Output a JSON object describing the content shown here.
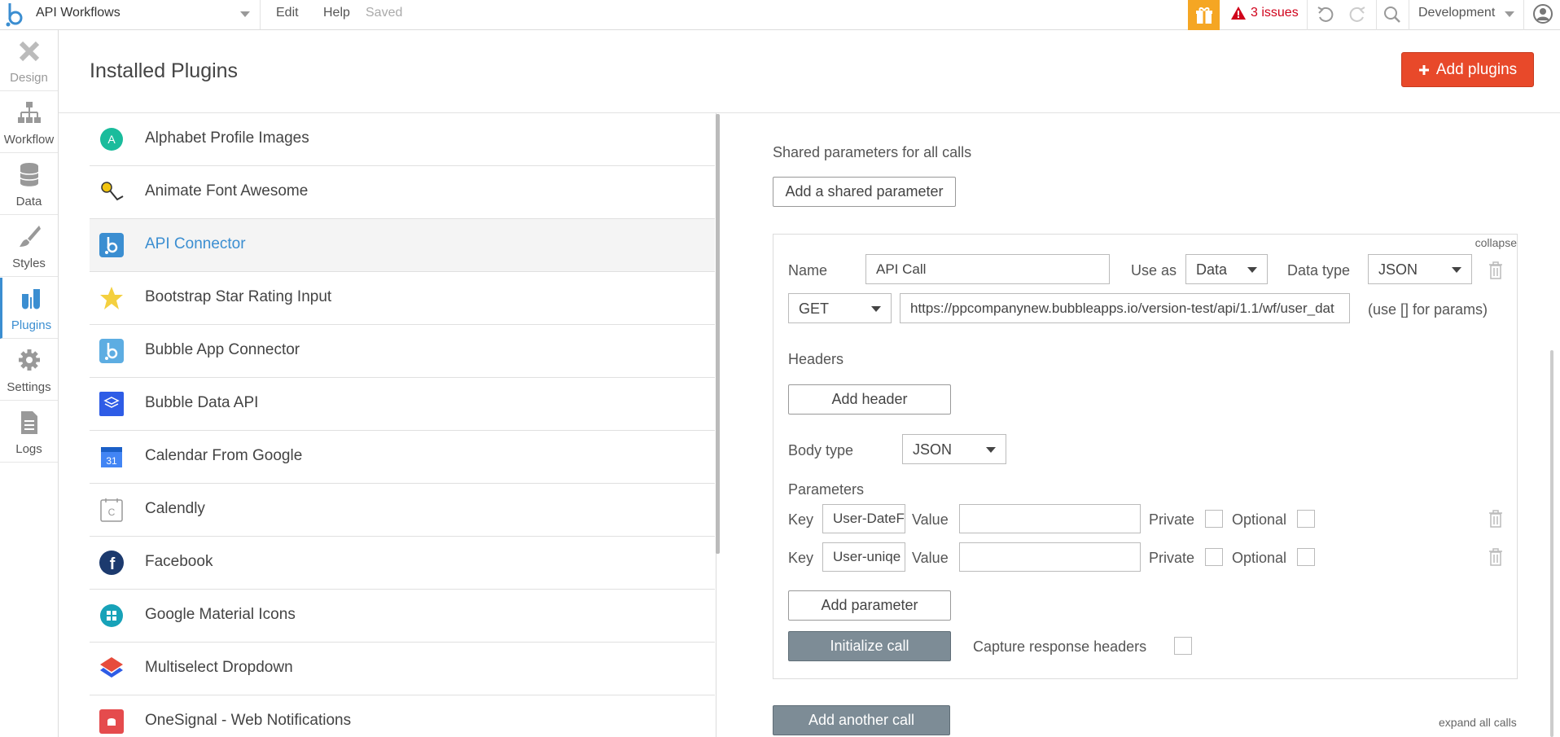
{
  "topbar": {
    "page_name": "API Workflows",
    "edit": "Edit",
    "help": "Help",
    "saved": "Saved",
    "issues": "3 issues",
    "environment": "Development"
  },
  "leftnav": {
    "items": [
      {
        "label": "Design",
        "icon": "design-icon"
      },
      {
        "label": "Workflow",
        "icon": "workflow-icon"
      },
      {
        "label": "Data",
        "icon": "database-icon"
      },
      {
        "label": "Styles",
        "icon": "brush-icon"
      },
      {
        "label": "Plugins",
        "icon": "plugins-icon"
      },
      {
        "label": "Settings",
        "icon": "gear-icon"
      },
      {
        "label": "Logs",
        "icon": "document-icon"
      }
    ],
    "active": "Plugins"
  },
  "header": {
    "title": "Installed Plugins",
    "add_plugins": "Add plugins"
  },
  "plugins": [
    {
      "name": "Alphabet Profile Images",
      "icon": "alphabet-icon"
    },
    {
      "name": "Animate Font Awesome",
      "icon": "animate-icon"
    },
    {
      "name": "API Connector",
      "icon": "bubble-icon",
      "selected": true
    },
    {
      "name": "Bootstrap Star Rating Input",
      "icon": "star-icon"
    },
    {
      "name": "Bubble App Connector",
      "icon": "bubble-icon"
    },
    {
      "name": "Bubble Data API",
      "icon": "layers-icon"
    },
    {
      "name": "Calendar From Google",
      "icon": "calendar-icon"
    },
    {
      "name": "Calendly",
      "icon": "calendly-icon"
    },
    {
      "name": "Facebook",
      "icon": "facebook-icon"
    },
    {
      "name": "Google Material Icons",
      "icon": "material-icon"
    },
    {
      "name": "Multiselect Dropdown",
      "icon": "multiselect-icon"
    },
    {
      "name": "OneSignal - Web Notifications",
      "icon": "onesignal-icon"
    }
  ],
  "api": {
    "shared_label": "Shared parameters for all calls",
    "add_shared": "Add a shared parameter",
    "collapse": "collapse",
    "name_label": "Name",
    "name_value": "API Call",
    "use_as_label": "Use as",
    "use_as_value": "Data",
    "data_type_label": "Data type",
    "data_type_value": "JSON",
    "method": "GET",
    "url": "https://ppcompanynew.bubbleapps.io/version-test/api/1.1/wf/user_dat",
    "url_hint": "(use [] for params)",
    "headers_label": "Headers",
    "add_header": "Add header",
    "body_type_label": "Body type",
    "body_type_value": "JSON",
    "parameters_label": "Parameters",
    "params": [
      {
        "key_label": "Key",
        "key": "User-DateF",
        "value_label": "Value",
        "value": "",
        "private_label": "Private",
        "optional_label": "Optional"
      },
      {
        "key_label": "Key",
        "key": "User-uniqe",
        "value_label": "Value",
        "value": "",
        "private_label": "Private",
        "optional_label": "Optional"
      }
    ],
    "add_parameter": "Add parameter",
    "initialize": "Initialize call",
    "capture_headers": "Capture response headers",
    "add_another": "Add another call",
    "expand_all": "expand all calls"
  }
}
